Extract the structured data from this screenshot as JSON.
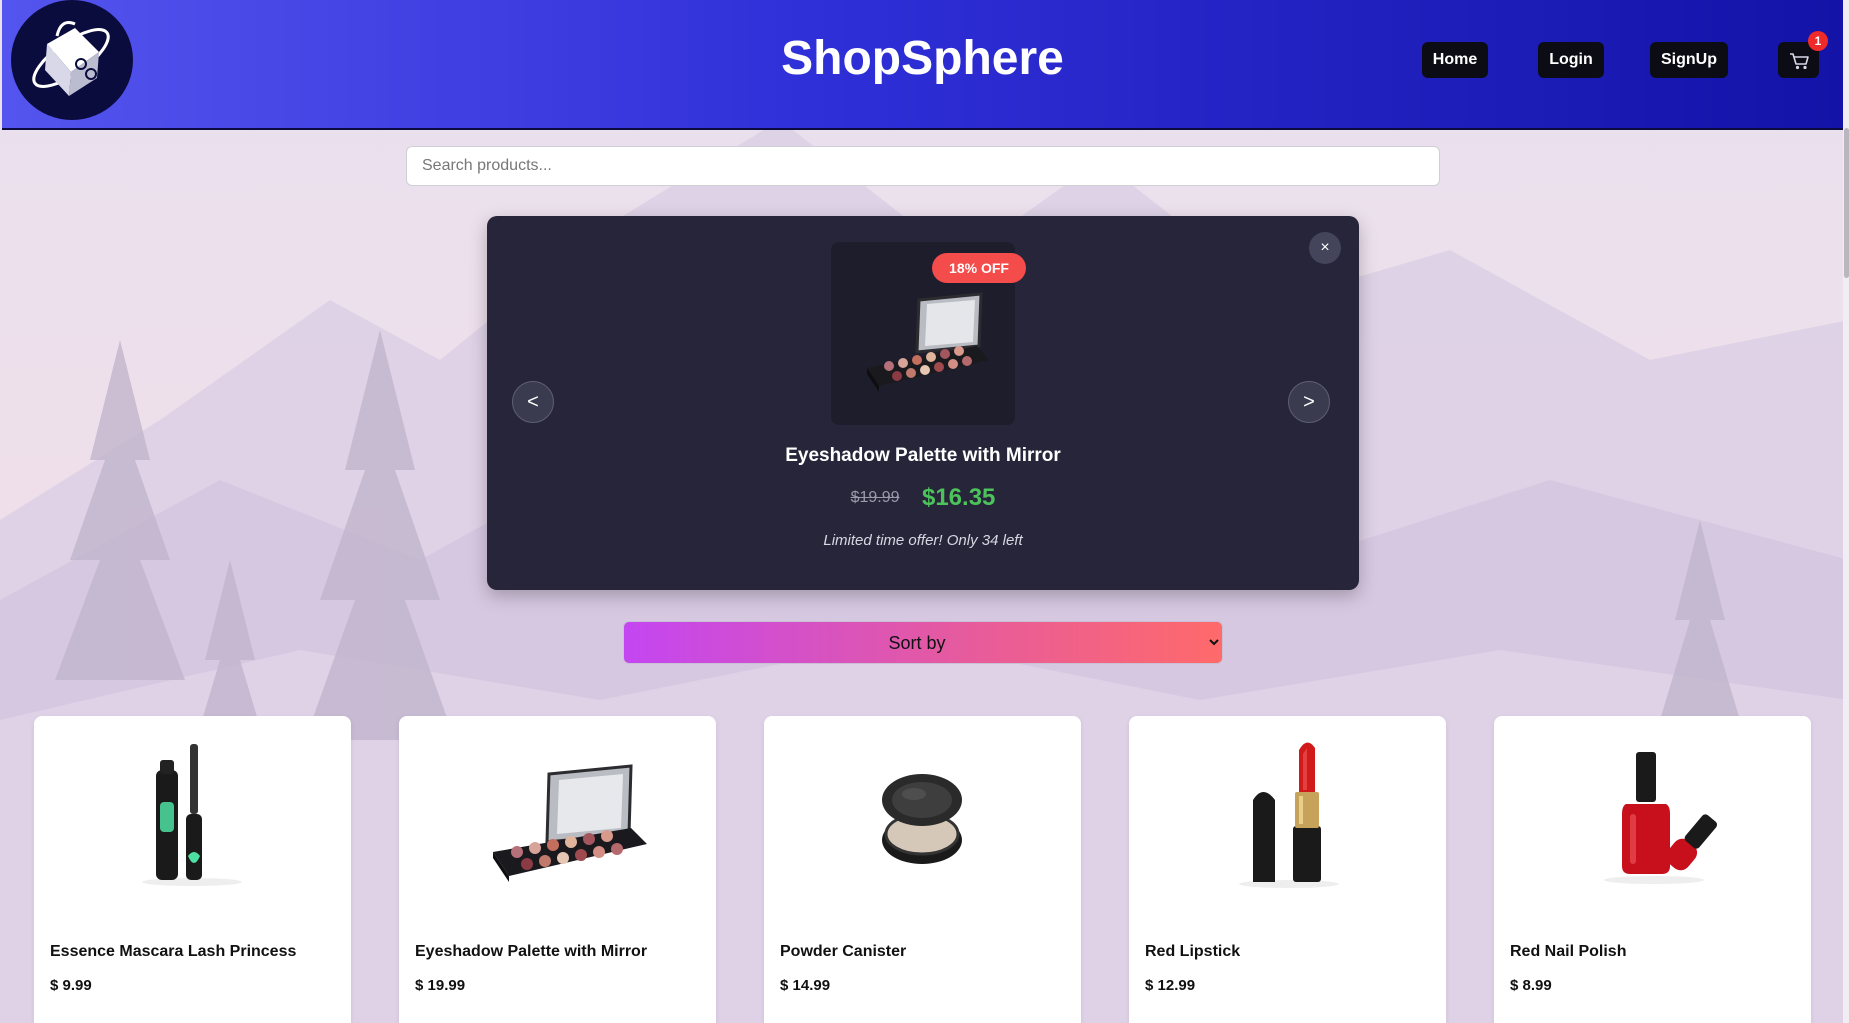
{
  "header": {
    "title": "ShopSphere",
    "nav": {
      "home": "Home",
      "login": "Login",
      "signup": "SignUp"
    },
    "cart_icon": "🛒",
    "cart_count": "1"
  },
  "search": {
    "placeholder": "Search products..."
  },
  "promo": {
    "close_label": "×",
    "prev_label": "<",
    "next_label": ">",
    "discount": "18% OFF",
    "product_name": "Eyeshadow Palette with Mirror",
    "old_price": "$19.99",
    "new_price": "$16.35",
    "note": "Limited time offer! Only 34 left"
  },
  "sort": {
    "selected": "Sort by"
  },
  "products": [
    {
      "name": "Essence Mascara Lash Princess",
      "price": "$ 9.99",
      "icon": "mascara-icon"
    },
    {
      "name": "Eyeshadow Palette with Mirror",
      "price": "$ 19.99",
      "icon": "palette-icon"
    },
    {
      "name": "Powder Canister",
      "price": "$ 14.99",
      "icon": "powder-icon"
    },
    {
      "name": "Red Lipstick",
      "price": "$ 12.99",
      "icon": "lipstick-icon"
    },
    {
      "name": "Red Nail Polish",
      "price": "$ 8.99",
      "icon": "nail-polish-icon"
    }
  ],
  "colors": {
    "header_start": "#5454ee",
    "header_end": "#1313a8",
    "promo_bg": "#27253a",
    "discount_badge": "#f44b4b",
    "new_price": "#4cc25a",
    "sort_start": "#c346f2",
    "sort_end": "#ff6a6a"
  }
}
